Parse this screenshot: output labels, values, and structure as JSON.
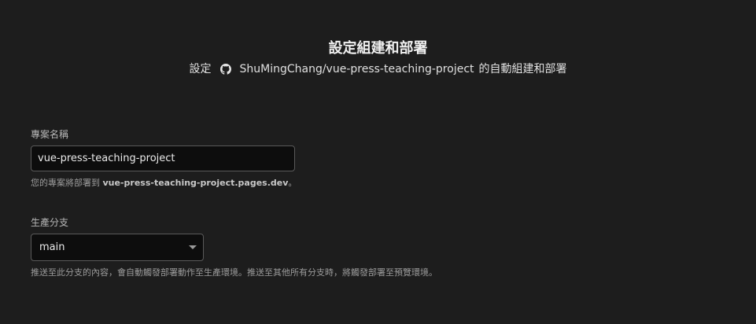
{
  "header": {
    "title": "設定組建和部署",
    "subtitle_prefix": "設定",
    "repo_icon": "github-icon",
    "repo": "ShuMingChang/vue-press-teaching-project",
    "subtitle_suffix": "的自動組建和部署"
  },
  "project_name": {
    "label": "專案名稱",
    "value": "vue-press-teaching-project",
    "help_prefix": "您的專案將部署到",
    "help_domain": "vue-press-teaching-project.pages.dev",
    "help_suffix": "。"
  },
  "production_branch": {
    "label": "生產分支",
    "selected": "main",
    "caret_icon": "chevron-down-icon",
    "help": "推送至此分支的內容，會自動觸發部署動作至生產環境。推送至其他所有分支時，將觸發部署至預覽環境。"
  }
}
